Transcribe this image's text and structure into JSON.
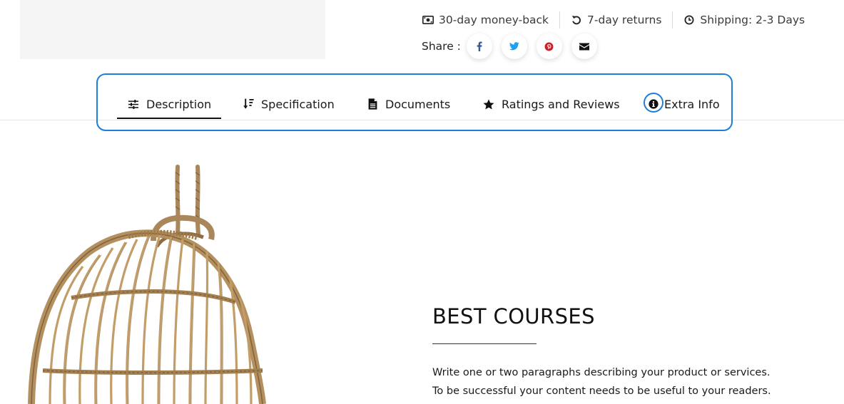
{
  "perks": [
    {
      "icon": "money-bill-icon",
      "label": "30-day money-back"
    },
    {
      "icon": "undo-icon",
      "label": "7-day returns"
    },
    {
      "icon": "clock-icon",
      "label": "Shipping: 2-3 Days"
    }
  ],
  "share": {
    "label": "Share :",
    "buttons": [
      {
        "icon": "facebook-icon",
        "color": "#3b5998"
      },
      {
        "icon": "twitter-icon",
        "color": "#1da1f2"
      },
      {
        "icon": "pinterest-icon",
        "color": "#cb2027"
      },
      {
        "icon": "envelope-icon",
        "color": "#111111"
      }
    ]
  },
  "tabs": [
    {
      "icon": "sliders-icon",
      "label": "Description",
      "active": true
    },
    {
      "icon": "sort-icon",
      "label": "Specification",
      "active": false
    },
    {
      "icon": "file-icon",
      "label": "Documents",
      "active": false
    },
    {
      "icon": "star-icon",
      "label": "Ratings and Reviews",
      "active": false
    },
    {
      "icon": "info-circle-icon",
      "label": "Extra Info",
      "active": false
    }
  ],
  "highlight_color": "#1d7fd6",
  "content": {
    "title": "BEST COURSES",
    "paragraph_lines": [
      "Write one or two paragraphs describing your product or services.",
      "To be successful your content needs to be useful to your readers."
    ]
  }
}
